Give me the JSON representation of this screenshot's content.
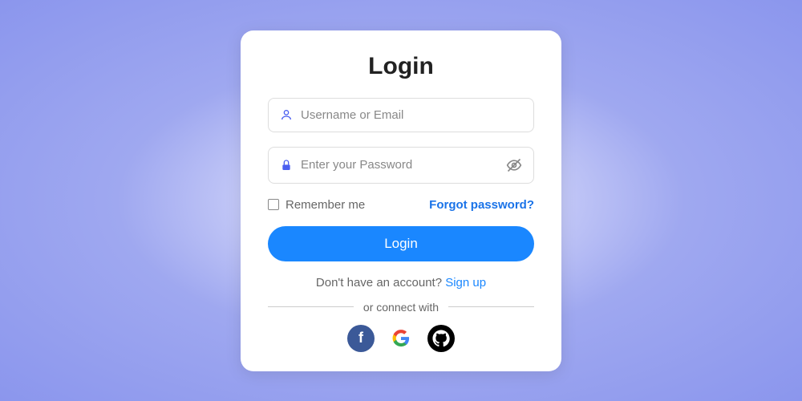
{
  "title": "Login",
  "username": {
    "placeholder": "Username or Email",
    "value": ""
  },
  "password": {
    "placeholder": "Enter your Password",
    "value": ""
  },
  "remember_label": "Remember me",
  "forgot_label": "Forgot password?",
  "login_button": "Login",
  "signup_prompt": "Don't have an account? ",
  "signup_link": "Sign up",
  "connect_label": "or connect with",
  "colors": {
    "primary": "#1a87ff",
    "link": "#1a73e8"
  }
}
